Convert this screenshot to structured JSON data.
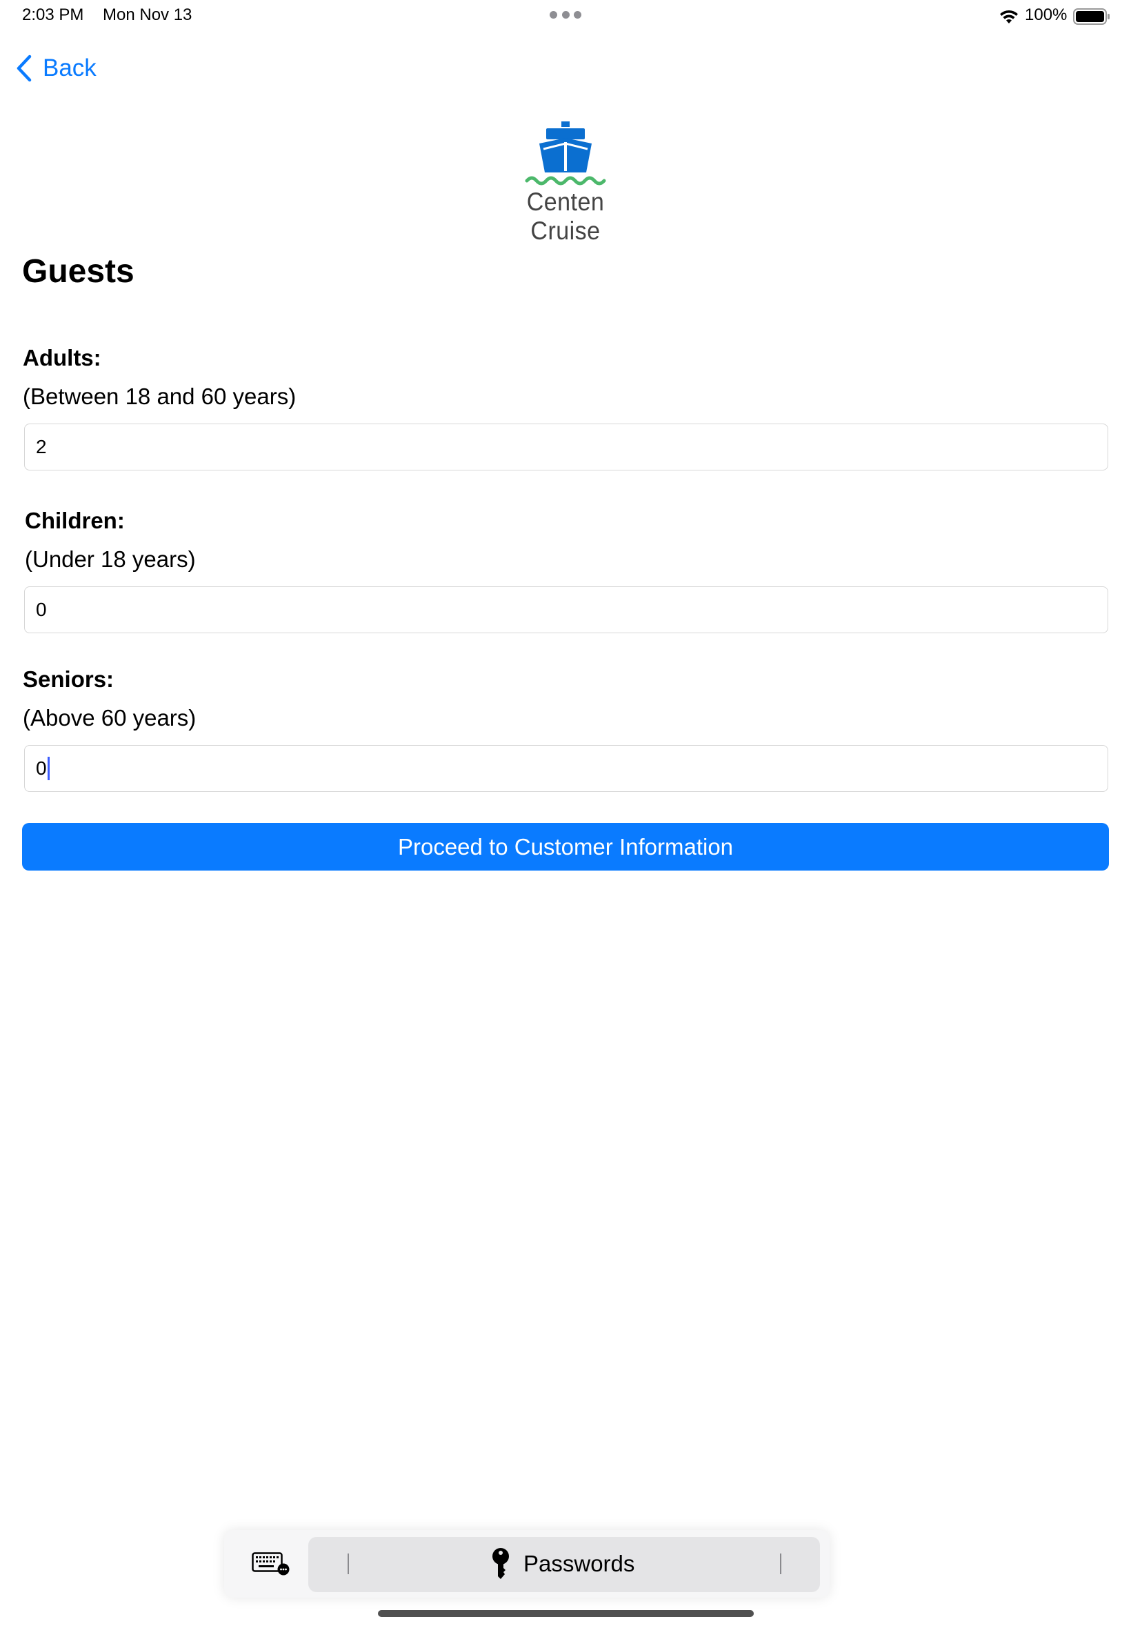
{
  "status_bar": {
    "time": "2:03 PM",
    "date": "Mon Nov 13",
    "battery": "100%"
  },
  "nav": {
    "back_label": "Back"
  },
  "logo": {
    "text": "Centen Cruise"
  },
  "page": {
    "title": "Guests"
  },
  "fields": {
    "adults": {
      "label": "Adults:",
      "hint": "(Between 18 and 60 years)",
      "value": "2"
    },
    "children": {
      "label": "Children:",
      "hint": "(Under 18 years)",
      "value": "0"
    },
    "seniors": {
      "label": "Seniors:",
      "hint": "(Above 60 years)",
      "value": "0"
    }
  },
  "actions": {
    "proceed_label": "Proceed to Customer Information"
  },
  "keyboard_bar": {
    "passwords_label": "Passwords"
  },
  "colors": {
    "accent": "#0a7bff",
    "logo_blue": "#0b6fd0",
    "logo_green": "#4cb86b"
  }
}
